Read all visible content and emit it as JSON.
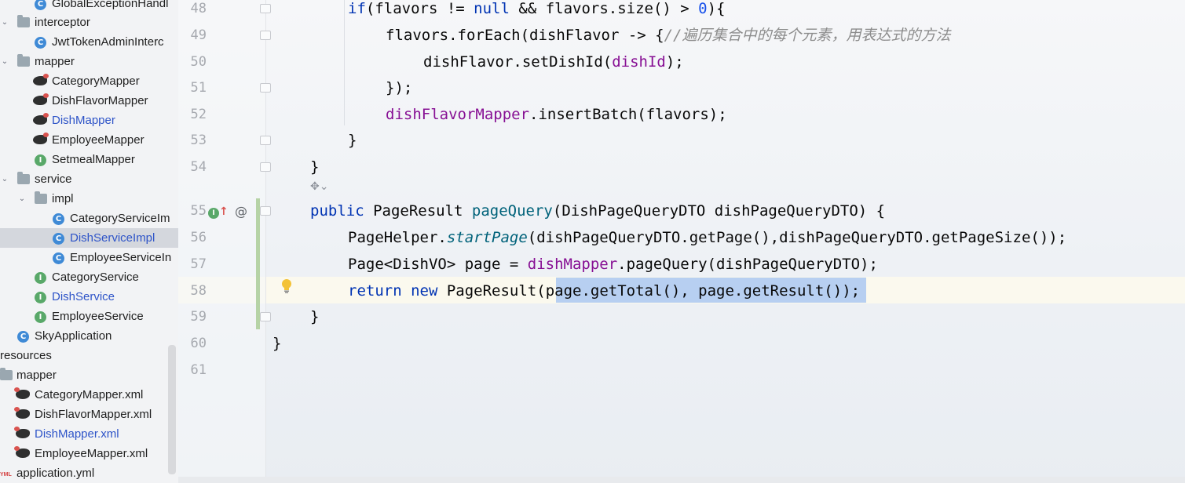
{
  "tree": {
    "items": [
      {
        "label": "GlobalExceptionHandl",
        "type": "class"
      },
      {
        "label": "interceptor",
        "type": "folder"
      },
      {
        "label": "JwtTokenAdminInterc",
        "type": "class"
      },
      {
        "label": "mapper",
        "type": "folder"
      },
      {
        "label": "CategoryMapper",
        "type": "mybatis"
      },
      {
        "label": "DishFlavorMapper",
        "type": "mybatis"
      },
      {
        "label": "DishMapper",
        "type": "mybatis"
      },
      {
        "label": "EmployeeMapper",
        "type": "mybatis"
      },
      {
        "label": "SetmealMapper",
        "type": "interface"
      },
      {
        "label": "service",
        "type": "folder"
      },
      {
        "label": "impl",
        "type": "folder"
      },
      {
        "label": "CategoryServiceIm",
        "type": "class"
      },
      {
        "label": "DishServiceImpl",
        "type": "class"
      },
      {
        "label": "EmployeeServiceIn",
        "type": "class"
      },
      {
        "label": "CategoryService",
        "type": "interface"
      },
      {
        "label": "DishService",
        "type": "interface"
      },
      {
        "label": "EmployeeService",
        "type": "interface"
      },
      {
        "label": "SkyApplication",
        "type": "app"
      },
      {
        "label": "resources",
        "type": "folder"
      },
      {
        "label": "mapper",
        "type": "folder"
      },
      {
        "label": "CategoryMapper.xml",
        "type": "xml"
      },
      {
        "label": "DishFlavorMapper.xml",
        "type": "xml"
      },
      {
        "label": "DishMapper.xml",
        "type": "xml"
      },
      {
        "label": "EmployeeMapper.xml",
        "type": "xml"
      },
      {
        "label": "application.yml",
        "type": "yml"
      }
    ],
    "selected": "DishServiceImpl",
    "icons": {
      "class": "C",
      "interface": "I",
      "yml": "YML"
    }
  },
  "editor": {
    "line_numbers": [
      "48",
      "49",
      "50",
      "51",
      "52",
      "53",
      "54",
      "55",
      "56",
      "57",
      "58",
      "59",
      "60",
      "61"
    ],
    "code": {
      "l48": {
        "p1": "if",
        "p2": "(flavors != ",
        "p3": "null",
        "p4": " && flavors.size() > ",
        "p5": "0",
        "p6": "){"
      },
      "l49": {
        "p1": "flavors.forEach(dishFlavor -> {",
        "p2": "//遍历集合中的每个元素，用表达式的方法"
      },
      "l50": {
        "p1": "dishFlavor.setDishId(",
        "p2": "dishId",
        "p3": ");"
      },
      "l51": {
        "p1": "});"
      },
      "l52": {
        "p1": "dishFlavorMapper",
        "p2": ".insertBatch(flavors);"
      },
      "l53": {
        "p1": "}"
      },
      "l54": {
        "p1": "}"
      },
      "l55": {
        "p1": "public",
        "p2": " PageResult ",
        "p3": "pageQuery",
        "p4": "(DishPageQueryDTO dishPageQueryDTO) {"
      },
      "l56": {
        "p1": "PageHelper.",
        "p2": "startPage",
        "p3": "(dishPageQueryDTO.getPage(),dishPageQueryDTO.getPageSize());"
      },
      "l57": {
        "p1": "Page<DishVO> page = ",
        "p2": "dishMapper",
        "p3": ".pageQuery(dishPageQueryDTO);"
      },
      "l58": {
        "p1": "return",
        "p2": " ",
        "p3": "new",
        "p4": " PageResult(",
        "p5": "page.getTotal(), page.getResult()",
        "p6": ");"
      },
      "l59": {
        "p1": "}"
      },
      "l60": {
        "p1": "}"
      }
    },
    "gutter_icons": {
      "impl": "I",
      "at": "@"
    }
  },
  "colors": {
    "keyword": "#0033b3",
    "field": "#871094",
    "comment": "#8c8c8c",
    "method": "#00627a",
    "selection": "#b7cff1",
    "tree_selected": "#d4d7dd"
  }
}
